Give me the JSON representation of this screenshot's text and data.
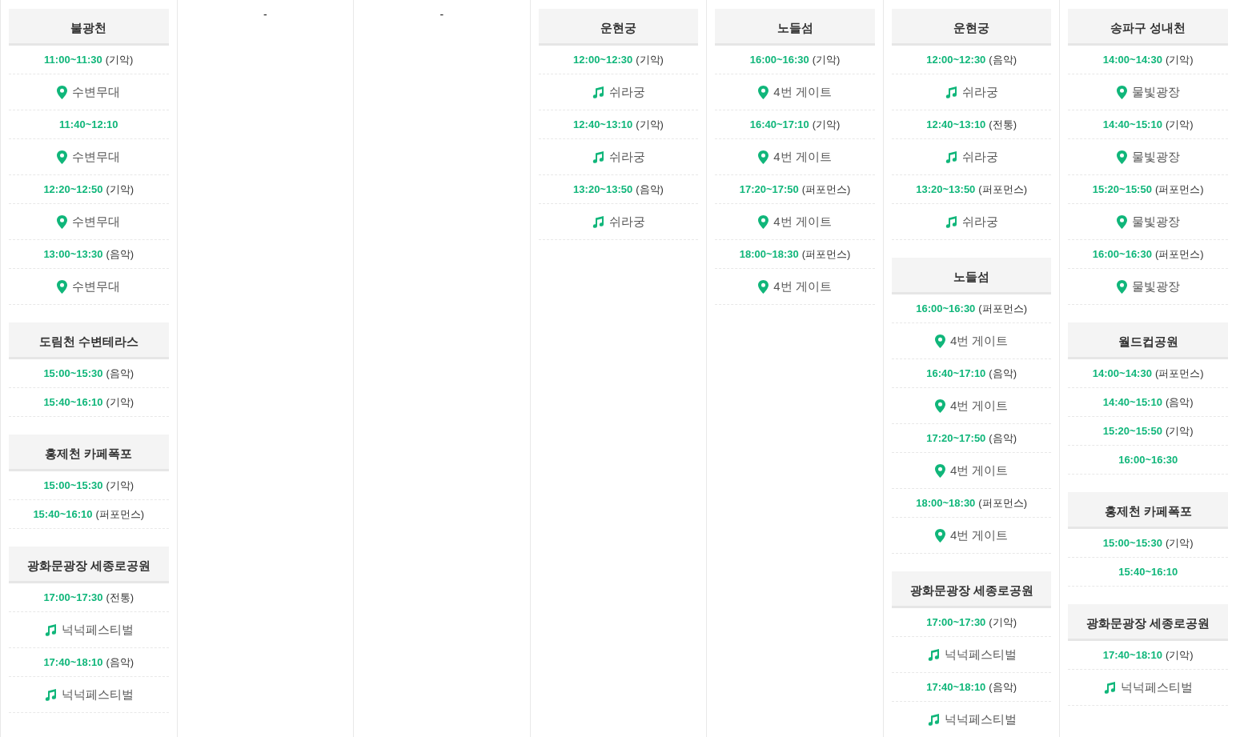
{
  "columns": [
    {
      "venues": [
        {
          "name": "불광천",
          "sessions": [
            {
              "time": "11:00~11:30",
              "category": "(기악)",
              "place": {
                "kind": "pin",
                "name": "수변무대"
              }
            },
            {
              "time": "11:40~12:10",
              "place": {
                "kind": "pin",
                "name": "수변무대"
              }
            },
            {
              "time": "12:20~12:50",
              "category": "(기악)",
              "place": {
                "kind": "pin",
                "name": "수변무대"
              }
            },
            {
              "time": "13:00~13:30",
              "category": "(음악)",
              "place": {
                "kind": "pin",
                "name": "수변무대"
              }
            }
          ]
        },
        {
          "name": "도림천 수변테라스",
          "sessions": [
            {
              "time": "15:00~15:30",
              "category": "(음악)"
            },
            {
              "time": "15:40~16:10",
              "category": "(기악)"
            }
          ]
        },
        {
          "name": "홍제천 카페폭포",
          "sessions": [
            {
              "time": "15:00~15:30",
              "category": "(기악)"
            },
            {
              "time": "15:40~16:10",
              "category": "(퍼포먼스)"
            }
          ]
        },
        {
          "name": "광화문광장 세종로공원",
          "sessions": [
            {
              "time": "17:00~17:30",
              "category": "(전통)",
              "place": {
                "kind": "note",
                "name": "넉넉페스티벌"
              }
            },
            {
              "time": "17:40~18:10",
              "category": "(음악)",
              "place": {
                "kind": "note",
                "name": "넉넉페스티벌"
              }
            }
          ]
        }
      ]
    },
    {
      "empty_text": "-"
    },
    {
      "empty_text": "-"
    },
    {
      "venues": [
        {
          "name": "운현궁",
          "sessions": [
            {
              "time": "12:00~12:30",
              "category": "(기악)",
              "place": {
                "kind": "note",
                "name": "쉬라궁"
              }
            },
            {
              "time": "12:40~13:10",
              "category": "(기악)",
              "place": {
                "kind": "note",
                "name": "쉬라궁"
              }
            },
            {
              "time": "13:20~13:50",
              "category": "(음악)",
              "place": {
                "kind": "note",
                "name": "쉬라궁"
              }
            }
          ]
        }
      ]
    },
    {
      "venues": [
        {
          "name": "노들섬",
          "sessions": [
            {
              "time": "16:00~16:30",
              "category": "(기악)",
              "place": {
                "kind": "pin",
                "name": "4번 게이트"
              }
            },
            {
              "time": "16:40~17:10",
              "category": "(기악)",
              "place": {
                "kind": "pin",
                "name": "4번 게이트"
              }
            },
            {
              "time": "17:20~17:50",
              "category": "(퍼포먼스)",
              "place": {
                "kind": "pin",
                "name": "4번 게이트"
              }
            },
            {
              "time": "18:00~18:30",
              "category": "(퍼포먼스)",
              "place": {
                "kind": "pin",
                "name": "4번 게이트"
              }
            }
          ]
        }
      ]
    },
    {
      "venues": [
        {
          "name": "운현궁",
          "sessions": [
            {
              "time": "12:00~12:30",
              "category": "(음악)",
              "place": {
                "kind": "note",
                "name": "쉬라궁"
              }
            },
            {
              "time": "12:40~13:10",
              "category": "(전통)",
              "place": {
                "kind": "note",
                "name": "쉬라궁"
              }
            },
            {
              "time": "13:20~13:50",
              "category": "(퍼포먼스)",
              "place": {
                "kind": "note",
                "name": "쉬라궁"
              }
            }
          ]
        },
        {
          "name": "노들섬",
          "sessions": [
            {
              "time": "16:00~16:30",
              "category": "(퍼포먼스)",
              "place": {
                "kind": "pin",
                "name": "4번 게이트"
              }
            },
            {
              "time": "16:40~17:10",
              "category": "(음악)",
              "place": {
                "kind": "pin",
                "name": "4번 게이트"
              }
            },
            {
              "time": "17:20~17:50",
              "category": "(음악)",
              "place": {
                "kind": "pin",
                "name": "4번 게이트"
              }
            },
            {
              "time": "18:00~18:30",
              "category": "(퍼포먼스)",
              "place": {
                "kind": "pin",
                "name": "4번 게이트"
              }
            }
          ]
        },
        {
          "name": "광화문광장 세종로공원",
          "sessions": [
            {
              "time": "17:00~17:30",
              "category": "(기악)",
              "place": {
                "kind": "note",
                "name": "넉넉페스티벌"
              }
            },
            {
              "time": "17:40~18:10",
              "category": "(음악)",
              "place": {
                "kind": "note",
                "name": "넉넉페스티벌"
              }
            }
          ]
        }
      ]
    },
    {
      "venues": [
        {
          "name": "송파구 성내천",
          "sessions": [
            {
              "time": "14:00~14:30",
              "category": "(기악)",
              "place": {
                "kind": "pin",
                "name": "물빛광장"
              }
            },
            {
              "time": "14:40~15:10",
              "category": "(기악)",
              "place": {
                "kind": "pin",
                "name": "물빛광장"
              }
            },
            {
              "time": "15:20~15:50",
              "category": "(퍼포먼스)",
              "place": {
                "kind": "pin",
                "name": "물빛광장"
              }
            },
            {
              "time": "16:00~16:30",
              "category": "(퍼포먼스)",
              "place": {
                "kind": "pin",
                "name": "물빛광장"
              }
            }
          ]
        },
        {
          "name": "월드컵공원",
          "sessions": [
            {
              "time": "14:00~14:30",
              "category": "(퍼포먼스)"
            },
            {
              "time": "14:40~15:10",
              "category": "(음악)"
            },
            {
              "time": "15:20~15:50",
              "category": "(기악)"
            },
            {
              "time": "16:00~16:30"
            }
          ]
        },
        {
          "name": "홍제천 카페폭포",
          "sessions": [
            {
              "time": "15:00~15:30",
              "category": "(기악)"
            },
            {
              "time": "15:40~16:10"
            }
          ]
        },
        {
          "name": "광화문광장 세종로공원",
          "sessions": [
            {
              "time": "17:40~18:10",
              "category": "(기악)",
              "place": {
                "kind": "note",
                "name": "넉넉페스티벌"
              }
            }
          ]
        }
      ]
    }
  ]
}
